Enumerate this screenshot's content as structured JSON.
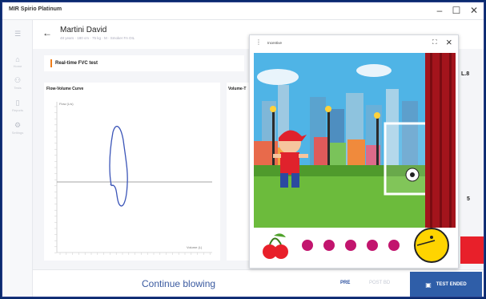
{
  "window": {
    "title": "MIR Spirio Platinum"
  },
  "header": {
    "patient_name": "Martini David",
    "patient_info": "48 years · 180 cm · 75 kg · M · Smoker FA OIL"
  },
  "sidebar": {
    "items": [
      {
        "icon": "menu-icon",
        "label": ""
      },
      {
        "icon": "home-icon",
        "label": "Home"
      },
      {
        "icon": "tests-icon",
        "label": "Tests"
      },
      {
        "icon": "reports-icon",
        "label": "Reports"
      },
      {
        "icon": "settings-icon",
        "label": "Settings"
      }
    ]
  },
  "section": {
    "title": "Real-time FVC test"
  },
  "chart1": {
    "title": "Flow-Volume Curve",
    "ylabel": "Flow (L/s)",
    "xlabel": "Volume (L)"
  },
  "chart2": {
    "title": "Volume-T"
  },
  "right_fragments": {
    "value1": "L.8",
    "value2": "5"
  },
  "incentive": {
    "title": "Incentive"
  },
  "bottom": {
    "status": "Continue blowing",
    "pre_label": "PRE",
    "post_label": "POST BD",
    "test_ended_label": "TEST ENDED"
  },
  "colors": {
    "accent": "#2f5ea8",
    "section_marker": "#ef7d1a",
    "dot": "#c2156e",
    "red_block": "#e8202a"
  }
}
